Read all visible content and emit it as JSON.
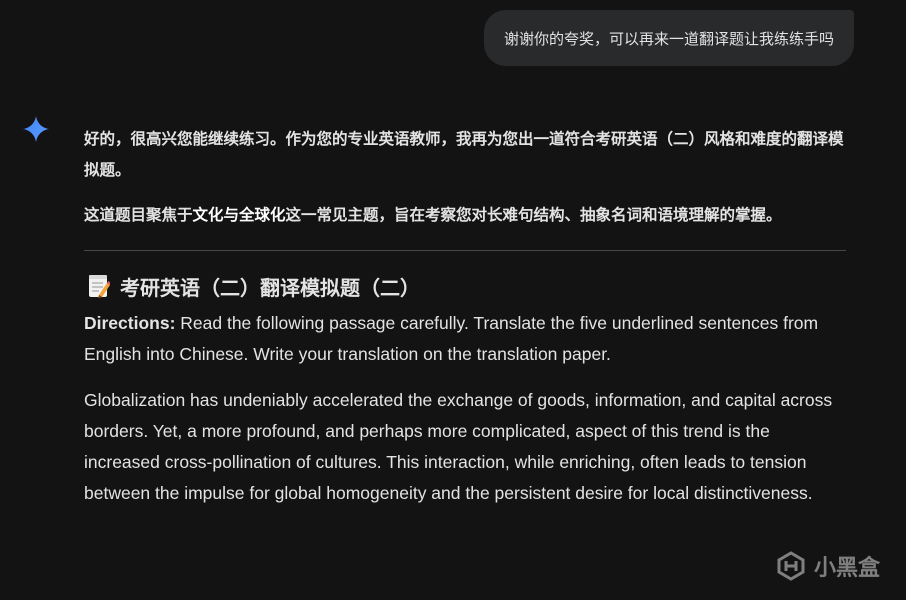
{
  "user_message": {
    "text": "谢谢你的夸奖，可以再来一道翻译题让我练练手吗"
  },
  "assistant": {
    "icon": "gemini-spark-icon",
    "accent_colors": [
      "#4285f4",
      "#9b72cb"
    ],
    "intro": "好的，很高兴您能继续练习。作为您的专业英语教师，我再为您出一道符合考研英语（二）风格和难度的翻译模拟题。",
    "focus_before": "这道题目聚焦于",
    "focus_bold": "文化与全球化",
    "focus_after": "这一常见主题，旨在考察您对长难句结构、抽象名词和语境理解的掌握。",
    "heading_icon": "memo-icon",
    "heading": "考研英语（二）翻译模拟题（二）",
    "directions_label": "Directions:",
    "directions_text": " Read the following passage carefully. Translate the five underlined sentences from English into Chinese. Write your translation on the translation paper.",
    "passage": "Globalization has undeniably accelerated the exchange of goods, information, and capital across borders. Yet, a more profound, and perhaps more complicated, aspect of this trend is the increased cross-pollination of cultures. This interaction, while enriching, often leads to tension between the impulse for global homogeneity and the persistent desire for local distinctiveness."
  },
  "watermark": {
    "icon": "heybox-logo-icon",
    "text": "小黑盒"
  }
}
